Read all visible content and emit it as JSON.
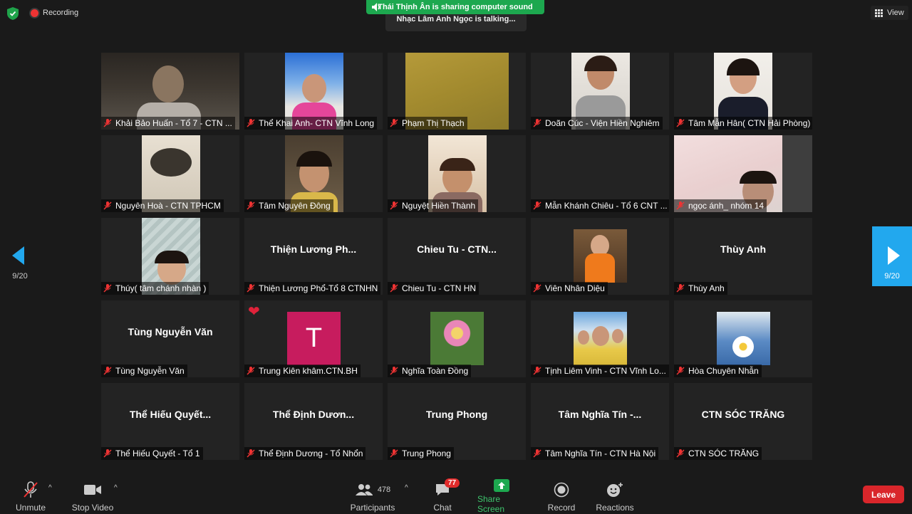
{
  "header": {
    "recording_label": "Recording",
    "share_banner": "Thái Thịnh Ân is sharing computer sound",
    "talking_text": "Nhạc Lâm Anh Ngọc is talking...",
    "view_label": "View"
  },
  "pagination": {
    "left": "9/20",
    "right": "9/20"
  },
  "participants": [
    {
      "name": "Khải Bảo Huấn - Tổ 7 - CTN ..."
    },
    {
      "name": "Thể Khai Anh- CTN Vĩnh Long"
    },
    {
      "name": "Phạm Thị Thạch"
    },
    {
      "name": "Doãn Cúc -  Viện Hiền Nghiêm"
    },
    {
      "name": "Tâm Mẫn Hân( CTN Hải Phòng)"
    },
    {
      "name": "Nguyên Hoà - CTN TPHCM"
    },
    {
      "name": "Tâm Nguyên Đông"
    },
    {
      "name": "Nguyệt Hiền Thành"
    },
    {
      "name": "Mẫn Khánh Chiêu - Tổ 6 CNT ..."
    },
    {
      "name": "ngọc ánh_ nhóm 14"
    },
    {
      "name": "Thúy( tâm chánh nhàn )"
    },
    {
      "name": "Thiện Lương Phổ-Tổ 8 CTNHN",
      "display": "Thiện Lương Ph..."
    },
    {
      "name": "Chieu Tu - CTN HN",
      "display": "Chieu Tu - CTN..."
    },
    {
      "name": "Viên Nhân Diệu"
    },
    {
      "name": "Thùy Anh",
      "display": "Thùy Anh"
    },
    {
      "name": "Tùng Nguyễn Văn",
      "display": "Tùng Nguyễn Văn"
    },
    {
      "name": "Trung Kiên khâm.CTN.BH",
      "avatar_letter": "T"
    },
    {
      "name": "Nghĩa Toàn Đồng"
    },
    {
      "name": "Tịnh Liêm Vinh - CTN Vĩnh Lo..."
    },
    {
      "name": "Hòa Chuyên Nhẫn"
    },
    {
      "name": "Thể Hiếu Quyết - Tổ 1",
      "display": "Thể Hiếu Quyết..."
    },
    {
      "name": "Thể Định Dương - Tổ Nhổn",
      "display": "Thể Định Dươn..."
    },
    {
      "name": "Trung Phong",
      "display": "Trung Phong"
    },
    {
      "name": "Tâm Nghĩa Tín - CTN Hà Nội",
      "display": "Tâm Nghĩa Tín -..."
    },
    {
      "name": "CTN SÓC TRĂNG",
      "display": "CTN SÓC TRĂNG"
    }
  ],
  "toolbar": {
    "unmute": "Unmute",
    "stop_video": "Stop Video",
    "participants": "Participants",
    "participants_count": "478",
    "chat": "Chat",
    "chat_badge": "77",
    "share_screen": "Share Screen",
    "record": "Record",
    "reactions": "Reactions",
    "leave": "Leave"
  },
  "colors": {
    "share_green": "#1da84f",
    "leave_red": "#d9262b",
    "nav_blue": "#22a8ee",
    "muted_red": "#e33"
  }
}
